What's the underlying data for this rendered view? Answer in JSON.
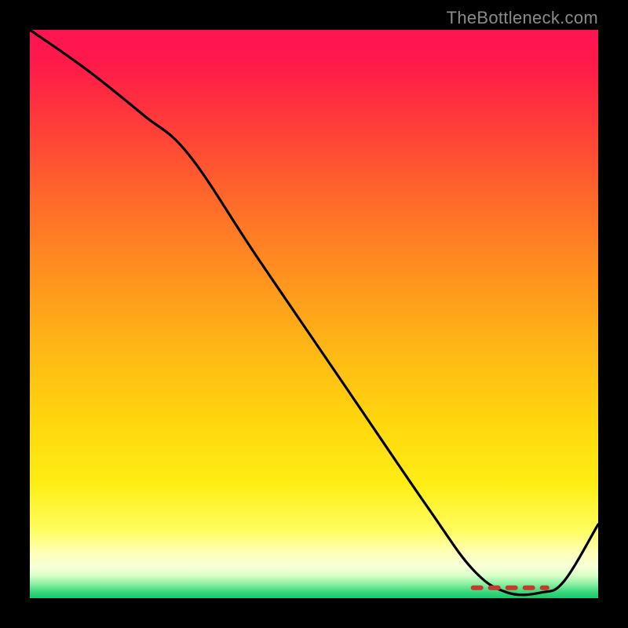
{
  "attribution": "TheBottleneck.com",
  "chart_data": {
    "type": "line",
    "title": "",
    "xlabel": "",
    "ylabel": "",
    "xlim": [
      0,
      100
    ],
    "ylim": [
      0,
      100
    ],
    "grid": false,
    "legend": false,
    "series": [
      {
        "name": "bottleneck-curve",
        "x": [
          0,
          10,
          20,
          28,
          40,
          55,
          70,
          78,
          84,
          90,
          94,
          100
        ],
        "y": [
          100,
          93,
          85,
          78,
          60,
          38,
          16,
          5,
          1,
          1,
          3,
          13
        ]
      }
    ],
    "annotations": [
      {
        "name": "optimal-range-dash",
        "x_from": 78,
        "x_to": 91,
        "y": 1
      }
    ],
    "background": "heatmap-gradient red→orange→yellow→green (top→bottom)"
  }
}
